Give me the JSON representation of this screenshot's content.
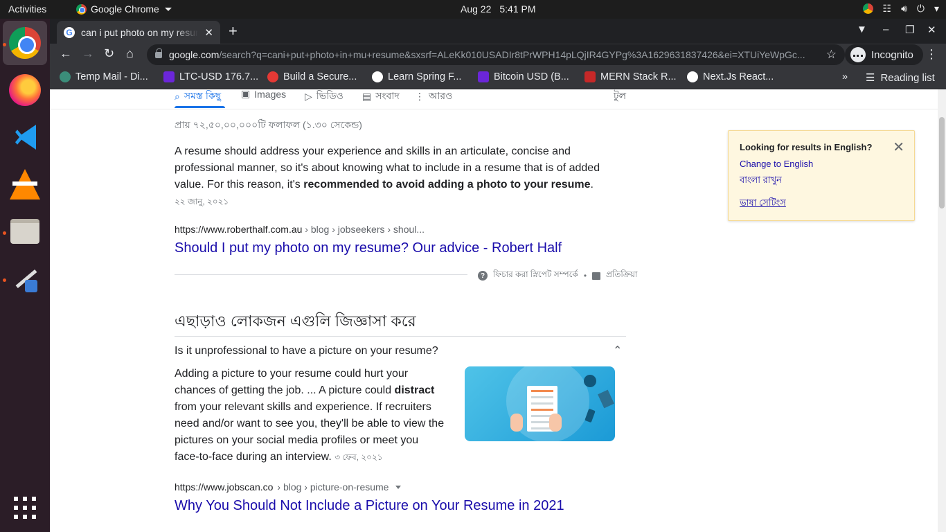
{
  "topbar": {
    "activities": "Activities",
    "app_name": "Google Chrome",
    "date": "Aug 22",
    "time": "5:41 PM"
  },
  "dock": {
    "items": [
      "Google Chrome",
      "Firefox",
      "Visual Studio Code",
      "VLC",
      "Files",
      "Paint",
      "Show Applications"
    ]
  },
  "browser": {
    "tab_title": "can i put photo on my resume",
    "url_domain": "google.com",
    "url_rest": "/search?q=cani+put+photo+in+mu+resume&sxsrf=ALeKk010USADIr8tPrWPH14pLQjIR4GYPg%3A1629631837426&ei=XTUiYeWpGc...",
    "incognito_label": "Incognito",
    "bookmarks": [
      {
        "label": "Temp Mail - Di...",
        "color": "#3b8d7a"
      },
      {
        "label": "LTC-USD 176.7...",
        "color": "#6b26d9"
      },
      {
        "label": "Build a Secure...",
        "color": "#e53935"
      },
      {
        "label": "Learn Spring F...",
        "color": "#ffffff"
      },
      {
        "label": "Bitcoin USD (B...",
        "color": "#6b26d9"
      },
      {
        "label": "MERN Stack R...",
        "color": "#c62828"
      },
      {
        "label": "Next.Js React...",
        "color": "#ffffff"
      }
    ],
    "reading_list": "Reading list"
  },
  "search": {
    "tabs": [
      "সমস্ত কিছু",
      "Images",
      "ভিডিও",
      "সংবাদ",
      "আরও"
    ],
    "tools": "টুল",
    "stats": "প্রায় ৭২,৫০,০০,০০০টি ফলাফল (১.৩০ সেকেন্ড)",
    "snippet_pre": "A resume should address your experience and skills in an articulate, concise and professional manner, so it's about knowing what to include in a resume that is of added value. For this reason, it's ",
    "snippet_bold": "recommended to avoid adding a photo to your resume",
    "snippet_post": ".",
    "snippet_date": "২২ জানু, ২০২১",
    "result1_domain": "https://www.roberthalf.com.au",
    "result1_path": " › blog › jobseekers › shoul...",
    "result1_title": "Should I put my photo on my resume? Our advice - Robert Half",
    "featured_about": "ফিচার করা স্নিপেট সম্পর্কে",
    "feedback": "প্রতিক্রিয়া",
    "paa_heading": "এছাড়াও লোকজন এগুলি জিজ্ঞাসা করে",
    "paa_question": "Is it unprofessional to have a picture on your resume?",
    "paa_answer_pre": "Adding a picture to your resume could hurt your chances of getting the job. ... A picture could ",
    "paa_answer_bold": "distract",
    "paa_answer_post": " from your relevant skills and experience. If recruiters need and/or want to see you, they'll be able to view the pictures on your social media profiles or meet you face-to-face during an interview.",
    "paa_date": "৩ ফেব, ২০২১",
    "result2_domain": "https://www.jobscan.co",
    "result2_path": " › blog › picture-on-resume",
    "result2_title": "Why You Should Not Include a Picture on Your Resume in 2021"
  },
  "lang_box": {
    "heading": "Looking for results in English?",
    "change": "Change to English",
    "keep": "বাংলা রাখুন",
    "settings": "ভাষা সেটিংস"
  }
}
